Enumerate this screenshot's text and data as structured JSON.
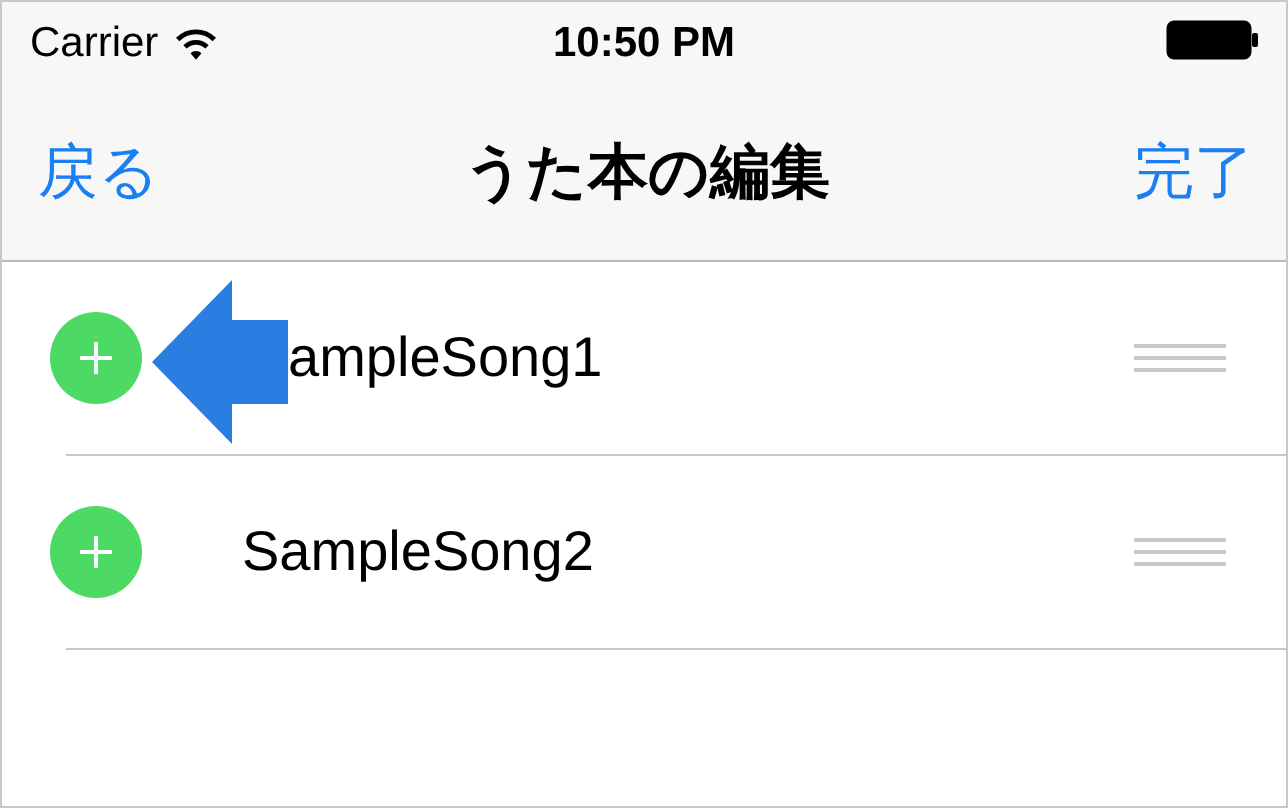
{
  "status_bar": {
    "carrier": "Carrier",
    "time": "10:50 PM"
  },
  "nav_bar": {
    "back": "戻る",
    "title": "うた本の編集",
    "done": "完了"
  },
  "rows": [
    {
      "title": "ampleSong1",
      "pointer_arrow": true
    },
    {
      "title": "SampleSong2",
      "pointer_arrow": false
    }
  ]
}
